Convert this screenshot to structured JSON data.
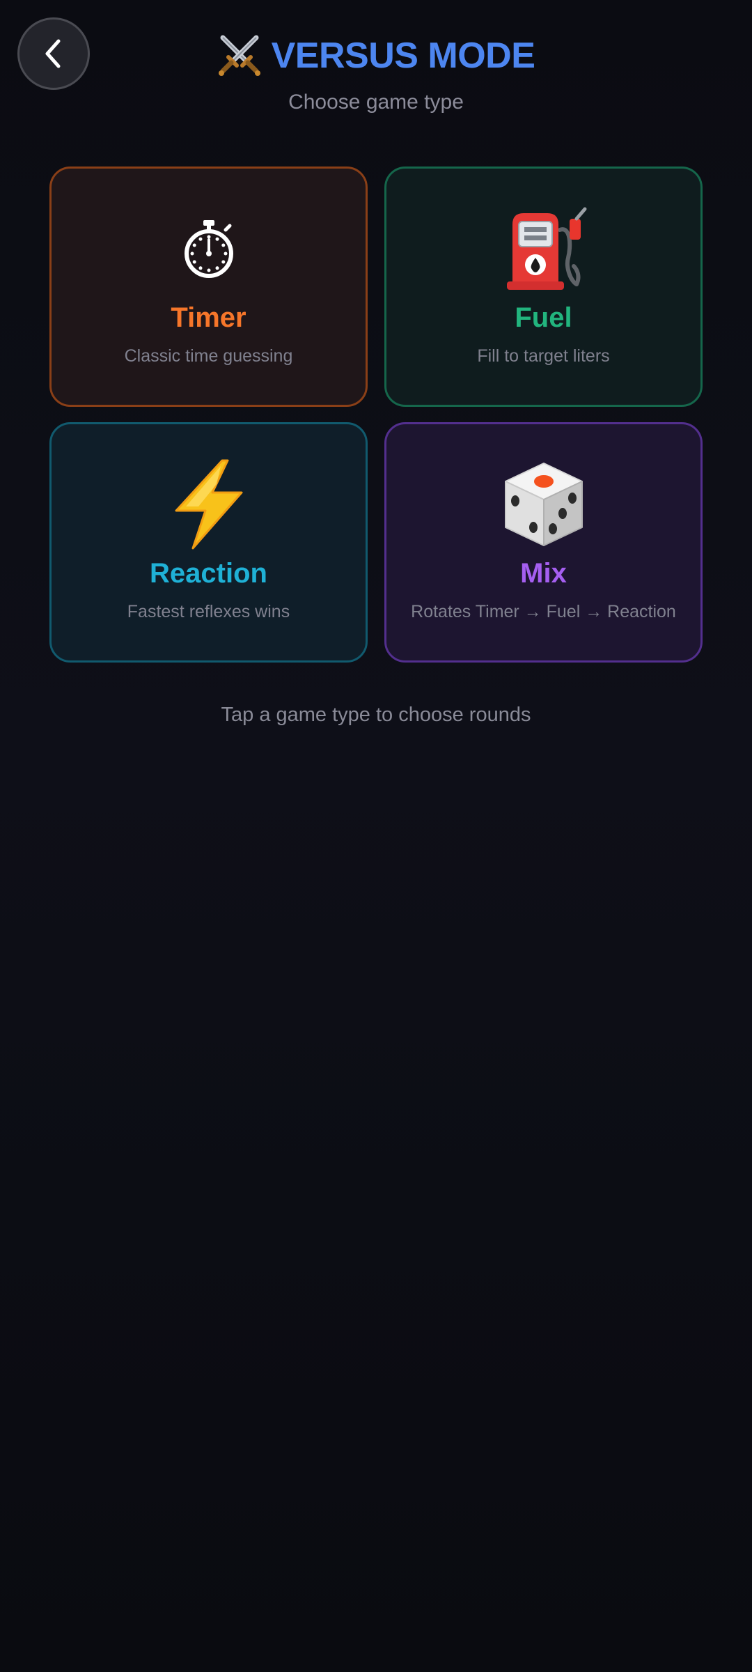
{
  "header": {
    "title": "VERSUS MODE",
    "subtitle": "Choose game type",
    "title_icon": "crossed-swords-icon",
    "title_color": "#4d86f0"
  },
  "back_button": {
    "icon": "chevron-left-icon"
  },
  "game_types": [
    {
      "id": "timer",
      "title": "Timer",
      "description": "Classic time guessing",
      "icon": "stopwatch-icon",
      "color": "#f6762a"
    },
    {
      "id": "fuel",
      "title": "Fuel",
      "description": "Fill to target liters",
      "icon": "fuel-pump-icon",
      "color": "#22b57e"
    },
    {
      "id": "reaction",
      "title": "Reaction",
      "description": "Fastest reflexes wins",
      "icon": "lightning-icon",
      "color": "#1fb1d6"
    },
    {
      "id": "mix",
      "title": "Mix",
      "description": "Rotates Timer → Fuel → Reaction",
      "icon": "dice-icon",
      "color": "#a55ff0"
    }
  ],
  "footer_hint": "Tap a game type to choose rounds"
}
